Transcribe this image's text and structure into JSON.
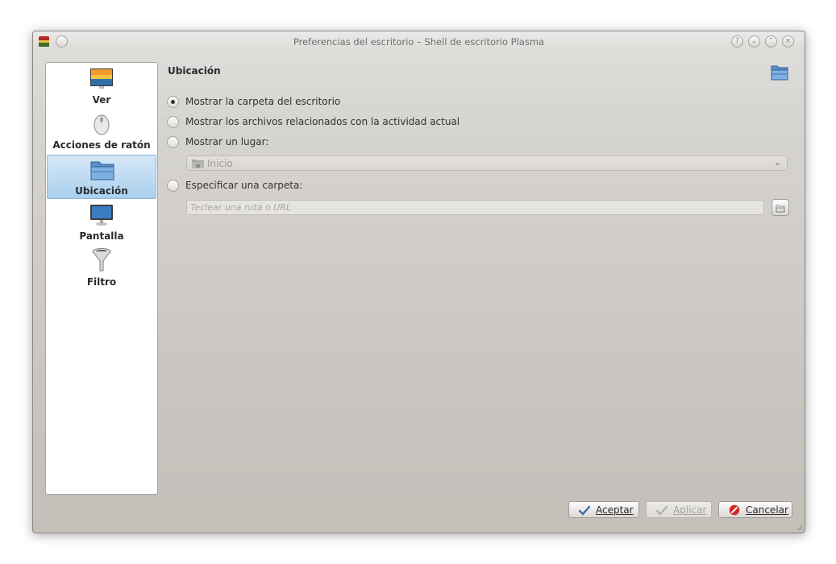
{
  "window": {
    "title": "Preferencias del escritorio – Shell de escritorio Plasma",
    "buttons": [
      {
        "name": "help-button",
        "glyph": "?"
      },
      {
        "name": "minimize-button",
        "glyph": "⌄"
      },
      {
        "name": "maximize-button",
        "glyph": "⌃"
      },
      {
        "name": "close-button",
        "glyph": "×"
      }
    ]
  },
  "sidebar": {
    "items": [
      {
        "label": "Ver",
        "icon": "wallpaper-icon",
        "selected": false
      },
      {
        "label": "Acciones de ratón",
        "icon": "mouse-icon",
        "selected": false
      },
      {
        "label": "Ubicación",
        "icon": "folder-icon",
        "selected": true
      },
      {
        "label": "Pantalla",
        "icon": "monitor-icon",
        "selected": false
      },
      {
        "label": "Filtro",
        "icon": "funnel-icon",
        "selected": false
      }
    ]
  },
  "main": {
    "section_title": "Ubicación",
    "section_icon": "folder-icon",
    "options": [
      {
        "label": "Mostrar la carpeta del escritorio",
        "checked": true
      },
      {
        "label": "Mostrar los archivos relacionados con la actividad actual",
        "checked": false
      },
      {
        "label": "Mostrar un lugar:",
        "checked": false
      },
      {
        "label": "Especificar una carpeta:",
        "checked": false
      }
    ],
    "place_combo": {
      "value": "Inicio",
      "icon": "home-folder-icon"
    },
    "folder_input": {
      "value": "",
      "placeholder": "Teclear una ruta o URL"
    }
  },
  "footer": {
    "ok_label": "Aceptar",
    "apply_label": "Aplicar",
    "cancel_label": "Cancelar"
  },
  "colors": {
    "selection": "#aad0ee",
    "folder_blue": "#5b8fc9",
    "cancel_red": "#d22a2a"
  }
}
